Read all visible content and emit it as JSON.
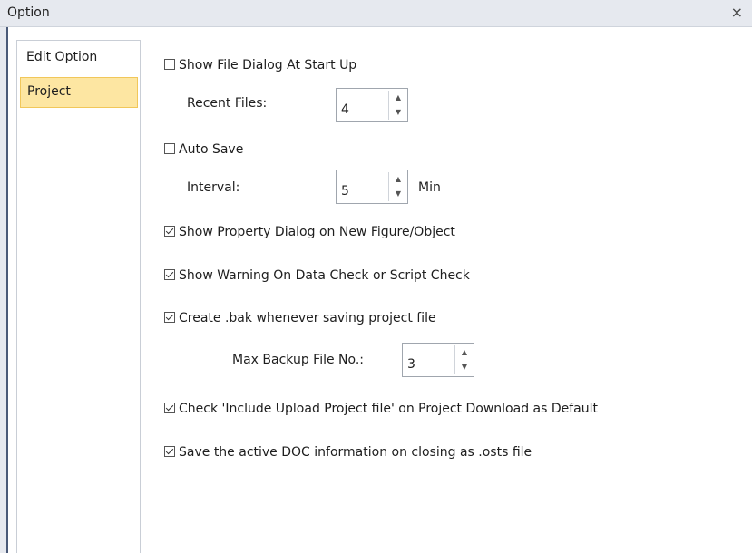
{
  "window": {
    "title": "Option",
    "close_glyph": "×"
  },
  "sidebar": {
    "items": [
      {
        "label": "Edit Option",
        "selected": false
      },
      {
        "label": "Project",
        "selected": true
      }
    ]
  },
  "options": {
    "show_file_dialog": {
      "label": "Show File Dialog At Start Up",
      "checked": false
    },
    "recent_files": {
      "label": "Recent Files:",
      "value": "4"
    },
    "auto_save": {
      "label": "Auto Save",
      "checked": false
    },
    "interval": {
      "label": "Interval:",
      "value": "5",
      "unit": "Min"
    },
    "show_property_dialog": {
      "label": "Show Property Dialog on New Figure/Object",
      "checked": true
    },
    "show_warning": {
      "label": "Show Warning On Data Check or Script Check",
      "checked": true
    },
    "create_bak": {
      "label": "Create .bak whenever saving project file",
      "checked": true
    },
    "max_backup": {
      "label": "Max Backup File No.:",
      "value": "3"
    },
    "include_upload": {
      "label": "Check 'Include Upload Project file' on Project Download as Default",
      "checked": true
    },
    "save_active_doc": {
      "label": "Save the active DOC information on closing as .osts file",
      "checked": true
    }
  },
  "spin_glyphs": {
    "up": "▲",
    "down": "▼"
  },
  "colors": {
    "selected_bg": "#fde6a2",
    "titlebar_bg": "#e6e9ef"
  }
}
